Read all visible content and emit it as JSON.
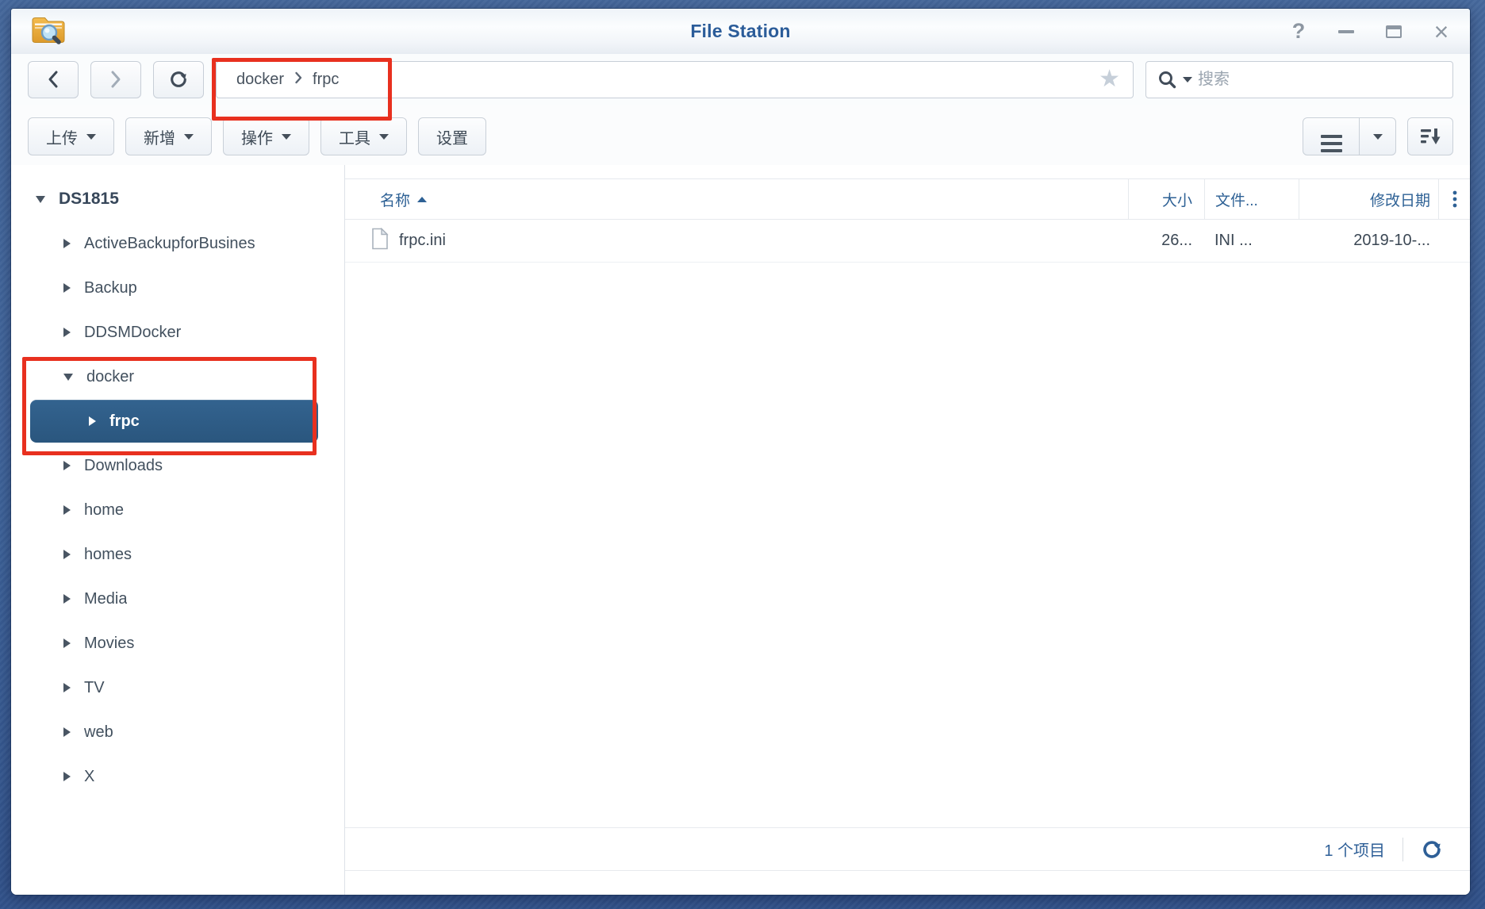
{
  "window": {
    "title": "File Station",
    "controls": {
      "help_glyph": "?",
      "close_glyph": "×"
    }
  },
  "nav": {
    "breadcrumb": {
      "items": [
        {
          "label": "docker"
        },
        {
          "label": "frpc"
        }
      ]
    },
    "star_glyph": "★",
    "search": {
      "placeholder": "搜索",
      "value": ""
    }
  },
  "toolbar": {
    "buttons": [
      {
        "label": "上传",
        "dropdown": true
      },
      {
        "label": "新增",
        "dropdown": true
      },
      {
        "label": "操作",
        "dropdown": true
      },
      {
        "label": "工具",
        "dropdown": true
      },
      {
        "label": "设置",
        "dropdown": false
      }
    ]
  },
  "sidebar": {
    "root_label": "DS1815",
    "items": [
      {
        "label": "ActiveBackupforBusines",
        "state": "collapsed"
      },
      {
        "label": "Backup",
        "state": "collapsed"
      },
      {
        "label": "DDSMDocker",
        "state": "collapsed"
      },
      {
        "label": "docker",
        "state": "expanded"
      },
      {
        "label": "frpc",
        "state": "selected"
      },
      {
        "label": "Downloads",
        "state": "collapsed"
      },
      {
        "label": "home",
        "state": "collapsed"
      },
      {
        "label": "homes",
        "state": "collapsed"
      },
      {
        "label": "Media",
        "state": "collapsed"
      },
      {
        "label": "Movies",
        "state": "collapsed"
      },
      {
        "label": "TV",
        "state": "collapsed"
      },
      {
        "label": "web",
        "state": "collapsed"
      },
      {
        "label": "X",
        "state": "collapsed"
      }
    ]
  },
  "main": {
    "columns": [
      {
        "label": "名称",
        "sort": "asc"
      },
      {
        "label": "大小"
      },
      {
        "label": "文件..."
      },
      {
        "label": "修改日期"
      }
    ],
    "rows": [
      {
        "name": "frpc.ini",
        "size": "26...",
        "type": "INI ...",
        "date": "2019-10-..."
      }
    ],
    "status": {
      "count_label": "1 个项目"
    }
  },
  "colors": {
    "accent_blue": "#2e6195",
    "selection_blue": "#2d5b8b",
    "annotation_red": "#e8301f",
    "desktop_blue": "#3e639a"
  }
}
